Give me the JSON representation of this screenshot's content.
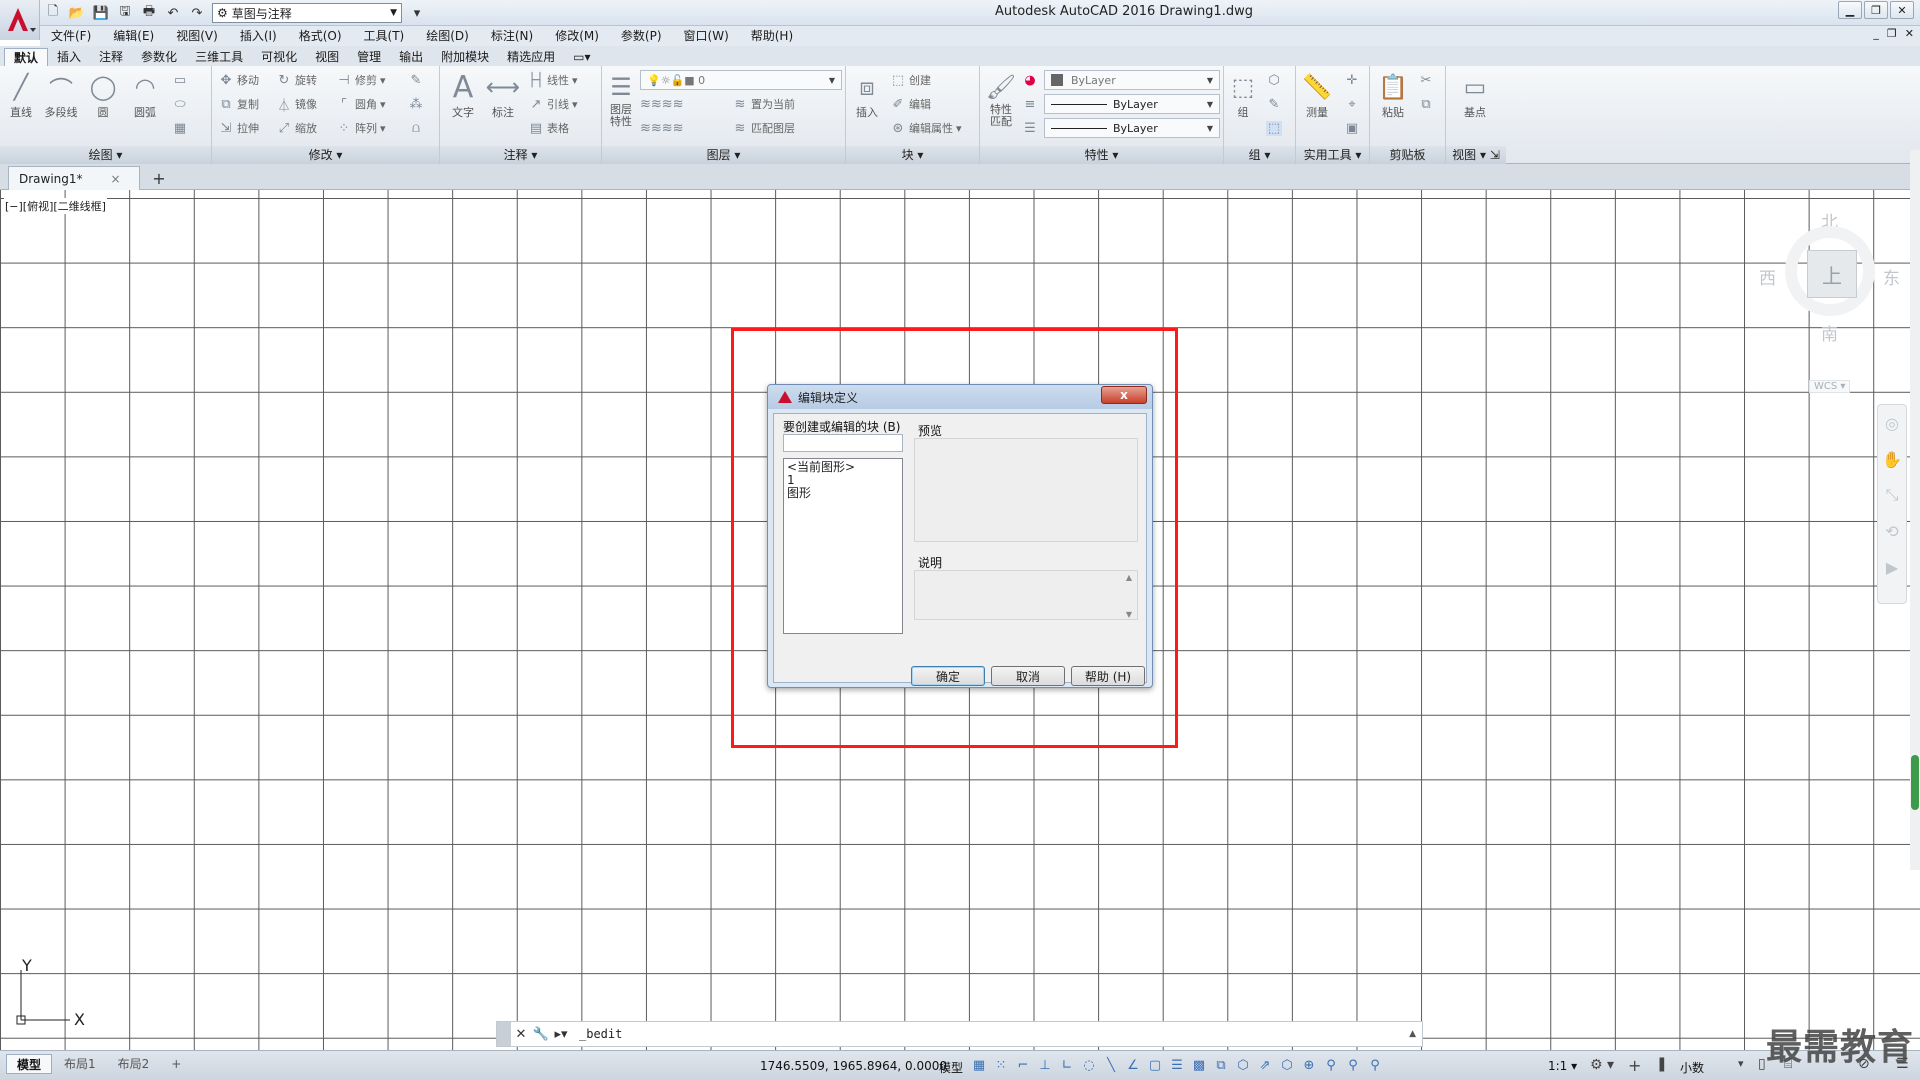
{
  "titlebar": {
    "workspace": "草图与注释",
    "app_title": "Autodesk AutoCAD 2016    Drawing1.dwg",
    "min_icon": "minimize-icon",
    "restore_icon": "restore-icon",
    "close_icon": "close-icon"
  },
  "menubar": [
    "文件(F)",
    "编辑(E)",
    "视图(V)",
    "插入(I)",
    "格式(O)",
    "工具(T)",
    "绘图(D)",
    "标注(N)",
    "修改(M)",
    "参数(P)",
    "窗口(W)",
    "帮助(H)"
  ],
  "ribbon_tabs": [
    "默认",
    "插入",
    "注释",
    "参数化",
    "三维工具",
    "可视化",
    "视图",
    "管理",
    "输出",
    "附加模块",
    "精选应用"
  ],
  "ribbon": {
    "draw": {
      "title": "绘图",
      "line": "直线",
      "polyline": "多段线",
      "circle": "圆",
      "arc": "圆弧"
    },
    "modify": {
      "title": "修改",
      "move": "移动",
      "rotate": "旋转",
      "trim": "修剪",
      "copy": "复制",
      "mirror": "镜像",
      "fillet": "圆角",
      "stretch": "拉伸",
      "scale": "缩放",
      "array": "阵列"
    },
    "annotation": {
      "title": "注释",
      "text": "文字",
      "dimension": "标注",
      "linear": "线性",
      "leader": "引线",
      "table": "表格"
    },
    "layers": {
      "title": "图层",
      "layer_props": "图层\n特性",
      "layer_value": "0",
      "set_current": "置为当前",
      "match_layer": "匹配图层"
    },
    "block": {
      "title": "块",
      "insert": "插入",
      "create": "创建",
      "edit": "编辑",
      "edit_attr": "编辑属性"
    },
    "properties": {
      "title": "特性",
      "match": "特性\n匹配",
      "color": "ByLayer",
      "linetype": "ByLayer",
      "lineweight": "ByLayer"
    },
    "groups": {
      "title": "组",
      "group": "组"
    },
    "utilities": {
      "title": "实用工具",
      "measure": "测量"
    },
    "clipboard": {
      "title": "剪贴板",
      "paste": "粘贴"
    },
    "view": {
      "title": "视图",
      "base": "基点"
    }
  },
  "filetab": {
    "doc": "Drawing1*",
    "close": "×",
    "new": "+"
  },
  "viewport": {
    "label": "[−][俯视][二维线框]",
    "viewcube": {
      "north": "北",
      "south": "南",
      "east": "东",
      "west": "西",
      "face": "上",
      "wcs": "WCS ▾"
    }
  },
  "ucs": {
    "y": "Y",
    "x": "X"
  },
  "dialog": {
    "title": "编辑块定义",
    "close_label": "x",
    "block_label": "要创建或编辑的块 (B)",
    "block_input": "",
    "list": [
      "<当前图形>",
      "1",
      "图形"
    ],
    "preview_label": "预览",
    "description_label": "说明",
    "ok": "确定",
    "cancel": "取消",
    "help": "帮助 (H)"
  },
  "command": {
    "text": "_bedit"
  },
  "statusbar": {
    "layouts": [
      "模型",
      "布局1",
      "布局2"
    ],
    "add_layout": "+",
    "coords": "1746.5509, 1965.8964, 0.0000",
    "model": "模型",
    "scale": "1:1 ▾",
    "units": "小数"
  },
  "watermark": "最需教育",
  "colors": {
    "highlight": "#ff1a1a",
    "accent": "#3a6fb4",
    "logo": "#c8102e"
  }
}
